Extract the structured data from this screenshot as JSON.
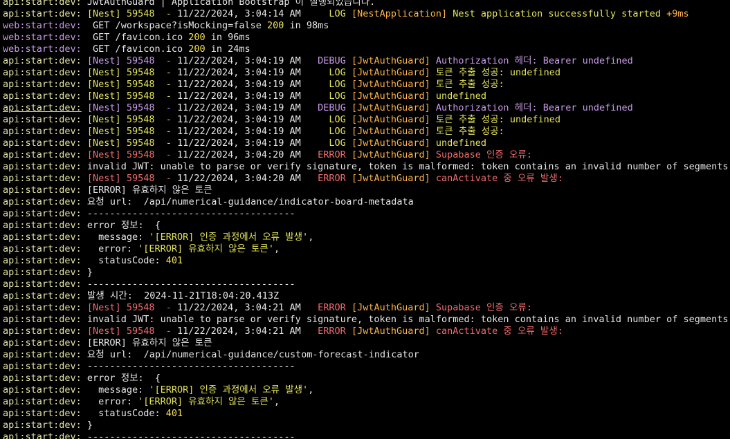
{
  "colors": {
    "background": "#000000",
    "api_prefix": "#e5e5a6",
    "web_prefix": "#c79be8",
    "log": "#e3e35a",
    "debug": "#c79be8",
    "error": "#ef6c6c",
    "tag": "#ffb347",
    "number": "#f0e050",
    "text": "#e6e6e6"
  },
  "lines": [
    {
      "segments": [
        {
          "t": "api:start:dev: ",
          "c": "api"
        },
        {
          "t": "JwtAuthGuard | Application Bootstrap 이 실행되었습니다.",
          "c": "white"
        }
      ]
    },
    {
      "segments": [
        {
          "t": "api:start:dev: ",
          "c": "api"
        },
        {
          "t": "[Nest] 59548  - ",
          "c": "log"
        },
        {
          "t": "11/22/2024, 3:04:14 AM",
          "c": "white"
        },
        {
          "t": "     LOG ",
          "c": "log"
        },
        {
          "t": "[NestApplication] ",
          "c": "tag"
        },
        {
          "t": "Nest application successfully started ",
          "c": "log"
        },
        {
          "t": "+9ms",
          "c": "tag"
        }
      ]
    },
    {
      "segments": [
        {
          "t": "web:start:dev: ",
          "c": "web"
        },
        {
          "t": " GET /workspace?isMocking=false ",
          "c": "white"
        },
        {
          "t": "200",
          "c": "num"
        },
        {
          "t": " in 98ms",
          "c": "white"
        }
      ]
    },
    {
      "segments": [
        {
          "t": "web:start:dev: ",
          "c": "web"
        },
        {
          "t": " GET /favicon.ico ",
          "c": "white"
        },
        {
          "t": "200",
          "c": "num"
        },
        {
          "t": " in 96ms",
          "c": "white"
        }
      ]
    },
    {
      "segments": [
        {
          "t": "web:start:dev: ",
          "c": "web"
        },
        {
          "t": " GET /favicon.ico ",
          "c": "white"
        },
        {
          "t": "200",
          "c": "num"
        },
        {
          "t": " in 24ms",
          "c": "white"
        }
      ]
    },
    {
      "segments": [
        {
          "t": "api:start:dev: ",
          "c": "api"
        },
        {
          "t": "[Nest] 59548  - ",
          "c": "purple"
        },
        {
          "t": "11/22/2024, 3:04:19 AM",
          "c": "white"
        },
        {
          "t": "   DEBUG ",
          "c": "purple"
        },
        {
          "t": "[JwtAuthGuard] ",
          "c": "tag"
        },
        {
          "t": "Authorization 헤더: Bearer undefined",
          "c": "purple"
        }
      ]
    },
    {
      "segments": [
        {
          "t": "api:start:dev: ",
          "c": "api"
        },
        {
          "t": "[Nest] 59548  - ",
          "c": "log"
        },
        {
          "t": "11/22/2024, 3:04:19 AM",
          "c": "white"
        },
        {
          "t": "     LOG ",
          "c": "log"
        },
        {
          "t": "[JwtAuthGuard] ",
          "c": "tag"
        },
        {
          "t": "토큰 추출 성공: undefined",
          "c": "log"
        }
      ]
    },
    {
      "segments": [
        {
          "t": "api:start:dev: ",
          "c": "api"
        },
        {
          "t": "[Nest] 59548  - ",
          "c": "log"
        },
        {
          "t": "11/22/2024, 3:04:19 AM",
          "c": "white"
        },
        {
          "t": "     LOG ",
          "c": "log"
        },
        {
          "t": "[JwtAuthGuard] ",
          "c": "tag"
        },
        {
          "t": "토큰 추출 성공:",
          "c": "log"
        }
      ]
    },
    {
      "segments": [
        {
          "t": "api:start:dev: ",
          "c": "api"
        },
        {
          "t": "[Nest] 59548  - ",
          "c": "log"
        },
        {
          "t": "11/22/2024, 3:04:19 AM",
          "c": "white"
        },
        {
          "t": "     LOG ",
          "c": "log"
        },
        {
          "t": "[JwtAuthGuard] ",
          "c": "tag"
        },
        {
          "t": "undefined",
          "c": "log"
        }
      ]
    },
    {
      "segments": [
        {
          "t": "api:start:dev:",
          "c": "api",
          "u": true
        },
        {
          "t": " ",
          "c": "white"
        },
        {
          "t": "[Nest] 59548  - ",
          "c": "purple"
        },
        {
          "t": "11/22/2024, 3:04:19 AM",
          "c": "white"
        },
        {
          "t": "   DEBUG ",
          "c": "purple"
        },
        {
          "t": "[JwtAuthGuard] ",
          "c": "tag"
        },
        {
          "t": "Authorization 헤더: Bearer undefined",
          "c": "purple"
        }
      ]
    },
    {
      "segments": [
        {
          "t": "api:start:dev: ",
          "c": "api"
        },
        {
          "t": "[Nest] 59548  - ",
          "c": "log"
        },
        {
          "t": "11/22/2024, 3:04:19 AM",
          "c": "white"
        },
        {
          "t": "     LOG ",
          "c": "log"
        },
        {
          "t": "[JwtAuthGuard] ",
          "c": "tag"
        },
        {
          "t": "토큰 추출 성공: undefined",
          "c": "log"
        }
      ]
    },
    {
      "segments": [
        {
          "t": "api:start:dev: ",
          "c": "api"
        },
        {
          "t": "[Nest] 59548  - ",
          "c": "log"
        },
        {
          "t": "11/22/2024, 3:04:19 AM",
          "c": "white"
        },
        {
          "t": "     LOG ",
          "c": "log"
        },
        {
          "t": "[JwtAuthGuard] ",
          "c": "tag"
        },
        {
          "t": "토큰 추출 성공:",
          "c": "log"
        }
      ]
    },
    {
      "segments": [
        {
          "t": "api:start:dev: ",
          "c": "api"
        },
        {
          "t": "[Nest] 59548  - ",
          "c": "log"
        },
        {
          "t": "11/22/2024, 3:04:19 AM",
          "c": "white"
        },
        {
          "t": "     LOG ",
          "c": "log"
        },
        {
          "t": "[JwtAuthGuard] ",
          "c": "tag"
        },
        {
          "t": "undefined",
          "c": "log"
        }
      ]
    },
    {
      "segments": [
        {
          "t": "api:start:dev: ",
          "c": "api"
        },
        {
          "t": "[Nest] 59548  - ",
          "c": "red"
        },
        {
          "t": "11/22/2024, 3:04:20 AM",
          "c": "white"
        },
        {
          "t": "   ERROR ",
          "c": "red"
        },
        {
          "t": "[JwtAuthGuard] ",
          "c": "tag"
        },
        {
          "t": "Supabase 인증 오류:",
          "c": "red"
        }
      ]
    },
    {
      "segments": [
        {
          "t": "api:start:dev: ",
          "c": "api"
        },
        {
          "t": "invalid JWT: unable to parse or verify signature, token is malformed: token contains an invalid number of segments",
          "c": "white"
        }
      ]
    },
    {
      "segments": [
        {
          "t": "api:start:dev: ",
          "c": "api"
        },
        {
          "t": "[Nest] 59548  - ",
          "c": "red"
        },
        {
          "t": "11/22/2024, 3:04:20 AM",
          "c": "white"
        },
        {
          "t": "   ERROR ",
          "c": "red"
        },
        {
          "t": "[JwtAuthGuard] ",
          "c": "tag"
        },
        {
          "t": "canActivate 중 오류 발생:",
          "c": "red"
        }
      ]
    },
    {
      "segments": [
        {
          "t": "api:start:dev: ",
          "c": "api"
        },
        {
          "t": "[ERROR] 유효하지 않은 토큰",
          "c": "white"
        }
      ]
    },
    {
      "segments": [
        {
          "t": "api:start:dev: ",
          "c": "api"
        },
        {
          "t": "요청 url:  /api/numerical-guidance/indicator-board-metadata",
          "c": "white"
        }
      ]
    },
    {
      "segments": [
        {
          "t": "api:start:dev: ",
          "c": "api"
        },
        {
          "t": "-------------------------------------",
          "c": "white"
        }
      ]
    },
    {
      "segments": [
        {
          "t": "api:start:dev: ",
          "c": "api"
        },
        {
          "t": "error 정보:  {",
          "c": "white"
        }
      ]
    },
    {
      "segments": [
        {
          "t": "api:start:dev: ",
          "c": "api"
        },
        {
          "t": "  message: ",
          "c": "white"
        },
        {
          "t": "'[ERROR] 인증 과정에서 오류 발생'",
          "c": "log"
        },
        {
          "t": ",",
          "c": "white"
        }
      ]
    },
    {
      "segments": [
        {
          "t": "api:start:dev: ",
          "c": "api"
        },
        {
          "t": "  error: ",
          "c": "white"
        },
        {
          "t": "'[ERROR] 유효하지 않은 토큰'",
          "c": "log"
        },
        {
          "t": ",",
          "c": "white"
        }
      ]
    },
    {
      "segments": [
        {
          "t": "api:start:dev: ",
          "c": "api"
        },
        {
          "t": "  statusCode: ",
          "c": "white"
        },
        {
          "t": "401",
          "c": "num"
        }
      ]
    },
    {
      "segments": [
        {
          "t": "api:start:dev: ",
          "c": "api"
        },
        {
          "t": "}",
          "c": "white"
        }
      ]
    },
    {
      "segments": [
        {
          "t": "api:start:dev: ",
          "c": "api"
        },
        {
          "t": "-------------------------------------",
          "c": "white"
        }
      ]
    },
    {
      "segments": [
        {
          "t": "api:start:dev: ",
          "c": "api"
        },
        {
          "t": "발생 시간:  2024-11-21T18:04:20.413Z",
          "c": "white"
        }
      ]
    },
    {
      "segments": [
        {
          "t": "api:start:dev: ",
          "c": "api"
        },
        {
          "t": "[Nest] 59548  - ",
          "c": "red"
        },
        {
          "t": "11/22/2024, 3:04:21 AM",
          "c": "white"
        },
        {
          "t": "   ERROR ",
          "c": "red"
        },
        {
          "t": "[JwtAuthGuard] ",
          "c": "tag"
        },
        {
          "t": "Supabase 인증 오류:",
          "c": "red"
        }
      ]
    },
    {
      "segments": [
        {
          "t": "api:start:dev: ",
          "c": "api"
        },
        {
          "t": "invalid JWT: unable to parse or verify signature, token is malformed: token contains an invalid number of segments",
          "c": "white"
        }
      ]
    },
    {
      "segments": [
        {
          "t": "api:start:dev: ",
          "c": "api"
        },
        {
          "t": "[Nest] 59548  - ",
          "c": "red"
        },
        {
          "t": "11/22/2024, 3:04:21 AM",
          "c": "white"
        },
        {
          "t": "   ERROR ",
          "c": "red"
        },
        {
          "t": "[JwtAuthGuard] ",
          "c": "tag"
        },
        {
          "t": "canActivate 중 오류 발생:",
          "c": "red"
        }
      ]
    },
    {
      "segments": [
        {
          "t": "api:start:dev: ",
          "c": "api"
        },
        {
          "t": "[ERROR] 유효하지 않은 토큰",
          "c": "white"
        }
      ]
    },
    {
      "segments": [
        {
          "t": "api:start:dev: ",
          "c": "api"
        },
        {
          "t": "요청 url:  /api/numerical-guidance/custom-forecast-indicator",
          "c": "white"
        }
      ]
    },
    {
      "segments": [
        {
          "t": "api:start:dev: ",
          "c": "api"
        },
        {
          "t": "-------------------------------------",
          "c": "white"
        }
      ]
    },
    {
      "segments": [
        {
          "t": "api:start:dev: ",
          "c": "api"
        },
        {
          "t": "error 정보:  {",
          "c": "white"
        }
      ]
    },
    {
      "segments": [
        {
          "t": "api:start:dev: ",
          "c": "api"
        },
        {
          "t": "  message: ",
          "c": "white"
        },
        {
          "t": "'[ERROR] 인증 과정에서 오류 발생'",
          "c": "log"
        },
        {
          "t": ",",
          "c": "white"
        }
      ]
    },
    {
      "segments": [
        {
          "t": "api:start:dev: ",
          "c": "api"
        },
        {
          "t": "  error: ",
          "c": "white"
        },
        {
          "t": "'[ERROR] 유효하지 않은 토큰'",
          "c": "log"
        },
        {
          "t": ",",
          "c": "white"
        }
      ]
    },
    {
      "segments": [
        {
          "t": "api:start:dev: ",
          "c": "api"
        },
        {
          "t": "  statusCode: ",
          "c": "white"
        },
        {
          "t": "401",
          "c": "num"
        }
      ]
    },
    {
      "segments": [
        {
          "t": "api:start:dev: ",
          "c": "api"
        },
        {
          "t": "}",
          "c": "white"
        }
      ]
    },
    {
      "segments": [
        {
          "t": "api:start:dev: ",
          "c": "api"
        },
        {
          "t": "-------------------------------------",
          "c": "white"
        }
      ]
    }
  ]
}
